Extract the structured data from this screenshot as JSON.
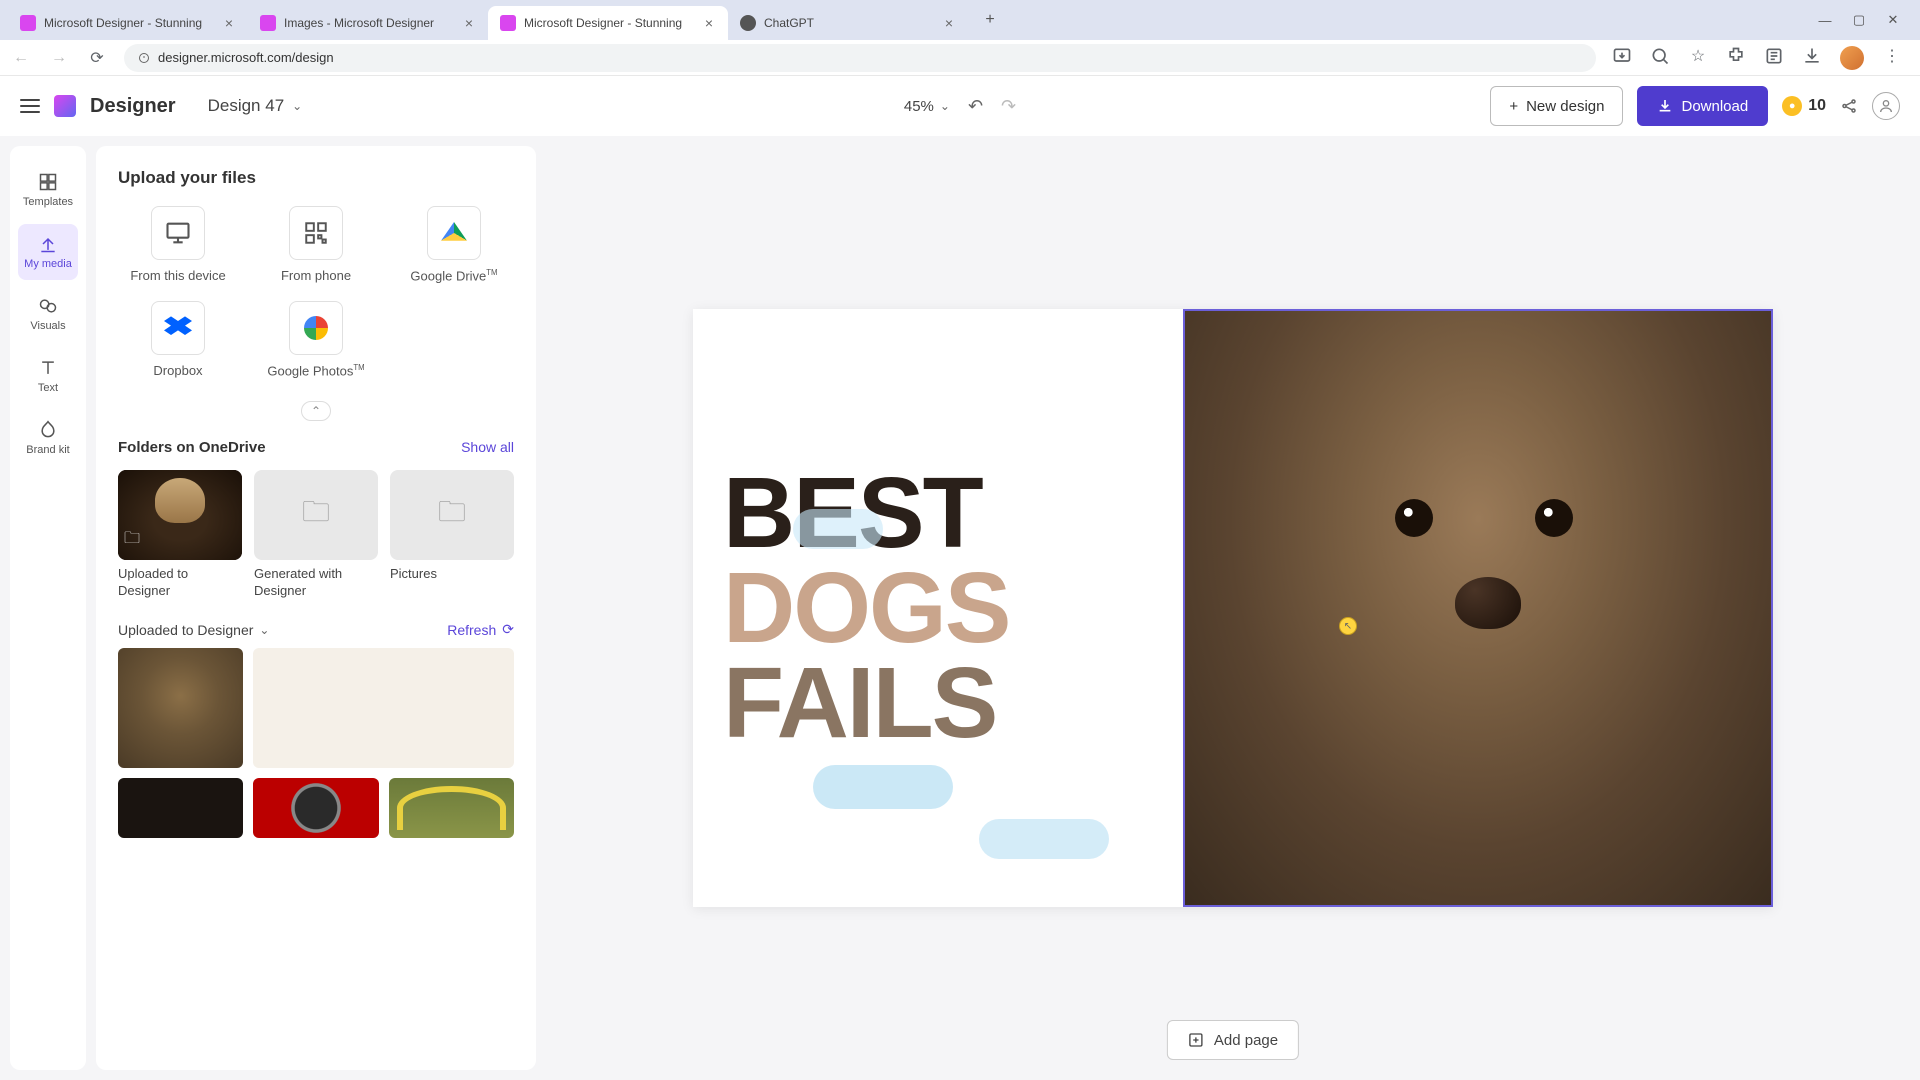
{
  "browser": {
    "tabs": [
      {
        "title": "Microsoft Designer - Stunning",
        "active": false,
        "favicon": "#d946ef"
      },
      {
        "title": "Images - Microsoft Designer",
        "active": false,
        "favicon": "#d946ef"
      },
      {
        "title": "Microsoft Designer - Stunning",
        "active": true,
        "favicon": "#d946ef"
      },
      {
        "title": "ChatGPT",
        "active": false,
        "favicon": "#555"
      }
    ],
    "url": "designer.microsoft.com/design"
  },
  "header": {
    "app_name": "Designer",
    "design_name": "Design 47",
    "zoom": "45%",
    "new_design": "New design",
    "download": "Download",
    "credits": "10"
  },
  "rail": {
    "templates": "Templates",
    "my_media": "My media",
    "visuals": "Visuals",
    "text": "Text",
    "brand_kit": "Brand kit"
  },
  "panel": {
    "upload_title": "Upload your files",
    "sources": {
      "device": "From this device",
      "phone": "From phone",
      "gdrive": "Google Drive",
      "dropbox": "Dropbox",
      "gphotos": "Google Photos"
    },
    "folders_title": "Folders on OneDrive",
    "show_all": "Show all",
    "folders": {
      "uploaded": "Uploaded to Designer",
      "generated": "Generated with Designer",
      "pictures": "Pictures"
    },
    "uploaded_section": "Uploaded to Designer",
    "refresh": "Refresh"
  },
  "canvas": {
    "line1": "BEST",
    "line2": "DOGS",
    "line3": "FAILS"
  },
  "add_page": "Add page"
}
